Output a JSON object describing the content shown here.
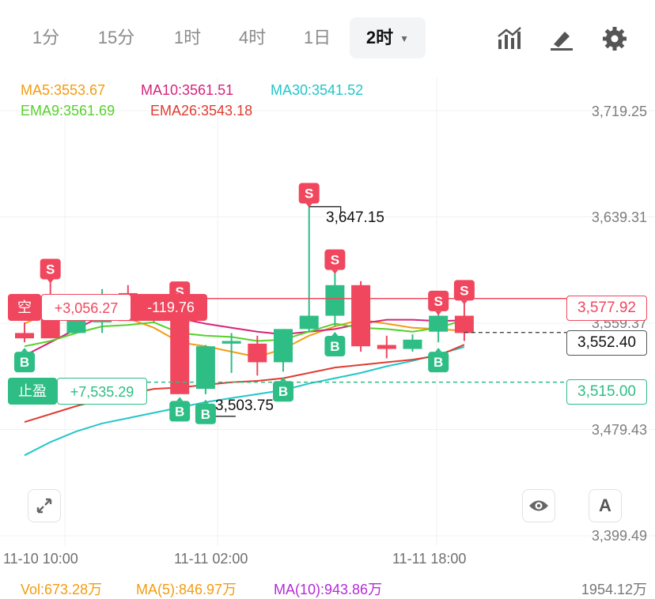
{
  "toolbar": {
    "timeframes": [
      "1分",
      "15分",
      "1时",
      "4时",
      "1日",
      "2时"
    ],
    "active": "2时"
  },
  "indicators": {
    "ma5": "MA5:3553.67",
    "ma10": "MA10:3561.51",
    "ma30": "MA30:3541.52",
    "ema9": "EMA9:3561.69",
    "ema26": "EMA26:3543.18"
  },
  "colors": {
    "up": "#2ebd85",
    "down": "#f0475e",
    "ma5": "#f39c12",
    "ma10": "#d6247a",
    "ma30": "#22c6c9",
    "ema9": "#55d12a",
    "ema26": "#e03c31"
  },
  "position": {
    "side": "空",
    "pnl": "+3,056.27",
    "pnl2": "-119.76",
    "entry_price": "3,577.92",
    "tp_label": "止盈",
    "tp_pnl": "+7,535.29",
    "tp_price": "3,515.00",
    "current_price": "3,552.40"
  },
  "markers": {
    "high": "3,647.15",
    "low": "3,503.75"
  },
  "volume": {
    "vol": "Vol:673.28万",
    "ma5": "MA(5):846.97万",
    "ma10": "MA(10):943.86万",
    "right": "1954.12万"
  },
  "buttons": {
    "text_tool": "A"
  },
  "chart_data": {
    "type": "candlestick",
    "interval": "2时",
    "price_ticks": [
      "3,719.25",
      "3,639.31",
      "3,559.37",
      "3,479.43",
      "3,399.49"
    ],
    "time_ticks": [
      "11-10 10:00",
      "11-11 02:00",
      "11-11 18:00"
    ],
    "ylim": [
      3399.49,
      3719.25
    ],
    "candles": [
      {
        "o": 3552,
        "h": 3560,
        "l": 3545,
        "c": 3548
      },
      {
        "o": 3580,
        "h": 3590,
        "l": 3548,
        "c": 3548
      },
      {
        "o": 3552,
        "h": 3575,
        "l": 3552,
        "c": 3575
      },
      {
        "o": 3560,
        "h": 3585,
        "l": 3552,
        "c": 3581
      },
      {
        "o": 3582,
        "h": 3588,
        "l": 3562,
        "c": 3561
      },
      {
        "o": 3564,
        "h": 3572,
        "l": 3560,
        "c": 3571
      },
      {
        "o": 3571,
        "h": 3573,
        "l": 3508,
        "c": 3506
      },
      {
        "o": 3510,
        "h": 3543,
        "l": 3506,
        "c": 3542
      },
      {
        "o": 3544,
        "h": 3552,
        "l": 3522,
        "c": 3546
      },
      {
        "o": 3544,
        "h": 3550,
        "l": 3520,
        "c": 3530
      },
      {
        "o": 3530,
        "h": 3555,
        "l": 3523,
        "c": 3555
      },
      {
        "o": 3555,
        "h": 3647,
        "l": 3553,
        "c": 3565
      },
      {
        "o": 3565,
        "h": 3597,
        "l": 3557,
        "c": 3588
      },
      {
        "o": 3588,
        "h": 3591,
        "l": 3538,
        "c": 3542
      },
      {
        "o": 3543,
        "h": 3550,
        "l": 3533,
        "c": 3540
      },
      {
        "o": 3540,
        "h": 3551,
        "l": 3538,
        "c": 3547
      },
      {
        "o": 3553,
        "h": 3566,
        "l": 3545,
        "c": 3565
      },
      {
        "o": 3565,
        "h": 3574,
        "l": 3546,
        "c": 3552
      }
    ],
    "series": [
      {
        "name": "MA5",
        "values": [
          3559,
          3568,
          3566,
          3567,
          3563,
          3556,
          3545,
          3542,
          3538,
          3534,
          3540,
          3550,
          3557,
          3562,
          3559,
          3556,
          3555,
          3553.67
        ]
      },
      {
        "name": "MA10",
        "values": [
          3535,
          3545,
          3555,
          3565,
          3571,
          3568,
          3563,
          3559,
          3556,
          3553,
          3551,
          3553,
          3555,
          3559,
          3562,
          3562,
          3561,
          3561.51
        ]
      },
      {
        "name": "MA30",
        "values": [
          3460,
          3470,
          3478,
          3484,
          3488,
          3492,
          3496,
          3500,
          3503,
          3506,
          3509,
          3514,
          3518,
          3522,
          3527,
          3531,
          3536,
          3541.52
        ]
      },
      {
        "name": "EMA9",
        "values": [
          3542,
          3546,
          3552,
          3557,
          3558,
          3560,
          3552,
          3550,
          3549,
          3546,
          3547,
          3553,
          3559,
          3556,
          3555,
          3553,
          3556,
          3561.69
        ]
      },
      {
        "name": "EMA26",
        "values": [
          3485,
          3491,
          3497,
          3502,
          3506,
          3510,
          3511,
          3513,
          3515,
          3516,
          3518,
          3522,
          3526,
          3528,
          3530,
          3532,
          3535,
          3543.18
        ]
      }
    ],
    "signals": [
      {
        "i": 1,
        "type": "S"
      },
      {
        "i": 0,
        "type": "B"
      },
      {
        "i": 6,
        "type": "S"
      },
      {
        "i": 6,
        "type": "B"
      },
      {
        "i": 7,
        "type": "B"
      },
      {
        "i": 10,
        "type": "B"
      },
      {
        "i": 11,
        "type": "S"
      },
      {
        "i": 12,
        "type": "S"
      },
      {
        "i": 12,
        "type": "B"
      },
      {
        "i": 16,
        "type": "S"
      },
      {
        "i": 16,
        "type": "B"
      },
      {
        "i": 17,
        "type": "S"
      }
    ]
  }
}
